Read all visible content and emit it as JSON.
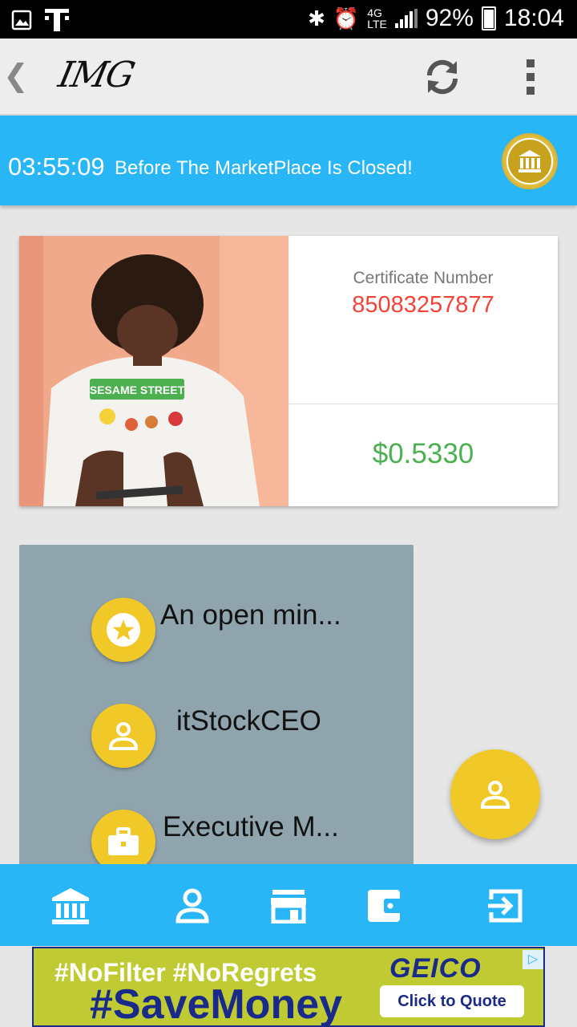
{
  "status_bar": {
    "battery": "92%",
    "time": "18:04",
    "icons": [
      "image-icon",
      "carrier-t-icon",
      "bluetooth-icon",
      "alarm-icon",
      "lte-icon",
      "signal-icon",
      "battery-icon"
    ]
  },
  "app_bar": {
    "back_glyph": "❮",
    "logo_text": "IMG",
    "refresh_icon": "refresh-icon",
    "menu_icon": "more-vert-icon"
  },
  "banner": {
    "timer": "03:55:09",
    "message": "Before The MarketPlace Is Closed!",
    "badge_icon": "bank-coin-icon"
  },
  "certificate": {
    "label": "Certificate Number",
    "number": "85083257877",
    "price": "$0.5330",
    "photo_shirt_text": "SESAME STREET"
  },
  "profile_rows": [
    {
      "icon": "star-icon",
      "text": "An open min..."
    },
    {
      "icon": "person-icon",
      "text": "itStockCEO"
    },
    {
      "icon": "briefcase-icon",
      "text": "Executive M..."
    }
  ],
  "fab": {
    "icon": "person-icon"
  },
  "bottom_nav": [
    {
      "icon": "bank-icon"
    },
    {
      "icon": "person-icon"
    },
    {
      "icon": "store-icon"
    },
    {
      "icon": "wallet-icon"
    },
    {
      "icon": "exit-icon"
    }
  ],
  "ad": {
    "line1": "#NoFilter  #NoRegrets",
    "line2": "#SaveMoney",
    "brand": "GEICO",
    "cta": "Click to Quote",
    "adchoices_glyph": "▷"
  },
  "colors": {
    "accent": "#29b6f6",
    "fab": "#f0c929",
    "panel": "#90a4ae",
    "cert_number": "#f44336",
    "price": "#4caf50"
  }
}
